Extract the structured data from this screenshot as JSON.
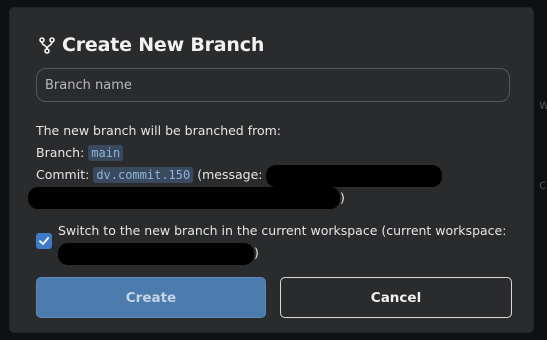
{
  "dialog": {
    "title": "Create New Branch",
    "icon": "git-branch-icon"
  },
  "branch_input": {
    "placeholder": "Branch name",
    "value": ""
  },
  "info": {
    "intro": "The new branch will be branched from:",
    "branch_label": "Branch:",
    "branch_value": "main",
    "commit_label": "Commit:",
    "commit_value": "dv.commit.150",
    "message_prefix": "(message:",
    "message_suffix": ")"
  },
  "switch_option": {
    "checked": true,
    "label": "Switch to the new branch in the current workspace (current workspace:",
    "label_suffix": ")"
  },
  "buttons": {
    "create": "Create",
    "cancel": "Cancel"
  },
  "colors": {
    "accent": "#3d7cc9",
    "create_button": "#4b7cad",
    "dialog_bg": "#2a2b2d",
    "code_bg": "#3a4a5e",
    "code_text": "#8fb3da"
  }
}
